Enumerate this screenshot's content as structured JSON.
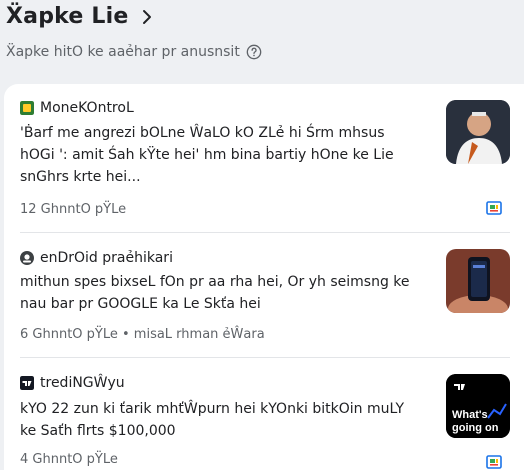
{
  "header": {
    "title": "Ẍapke Lie",
    "subtitle": "Ẍapke hitO ke aaẻhar pr anusnsit"
  },
  "stories": [
    {
      "source": "MoneKOntroL",
      "headline": "'Ḃarf me angrezi bOLne ŴaLO kO ZLẻ hi Śrm mhsus hOGi ': amit Śah kŸte hei' hm bina ḃartiy hOne ke Lie snGhrs krte hei...",
      "meta": "12 GhnntO pŸLe"
    },
    {
      "source": "enDrOid praẻhikari",
      "headline": "mithun spes bixseL fOn pr aa rha hei, Or yh seimsng ke nau bar pr GOOGLE ka Le Skťa hei",
      "meta": "6 GhnntO pŸLe • misaL rhman ẻŴara"
    },
    {
      "source": "trediNGŴyu",
      "headline": "kYO 22 zun ki ťarik mhťŴpurn hei kYOnki bitkOin muLY ke Saťh flrts $100,000",
      "meta": "4 GhnntO pŸLe"
    }
  ],
  "thumb3_text": "What's going on",
  "colors": {
    "accent": "#1a73e8",
    "moneycontrol": "#2e7d32",
    "android": "#3c4043",
    "tradingview": "#131722"
  },
  "icons": [
    "chevron-right-icon",
    "help-circle-icon",
    "full-coverage-icon"
  ]
}
